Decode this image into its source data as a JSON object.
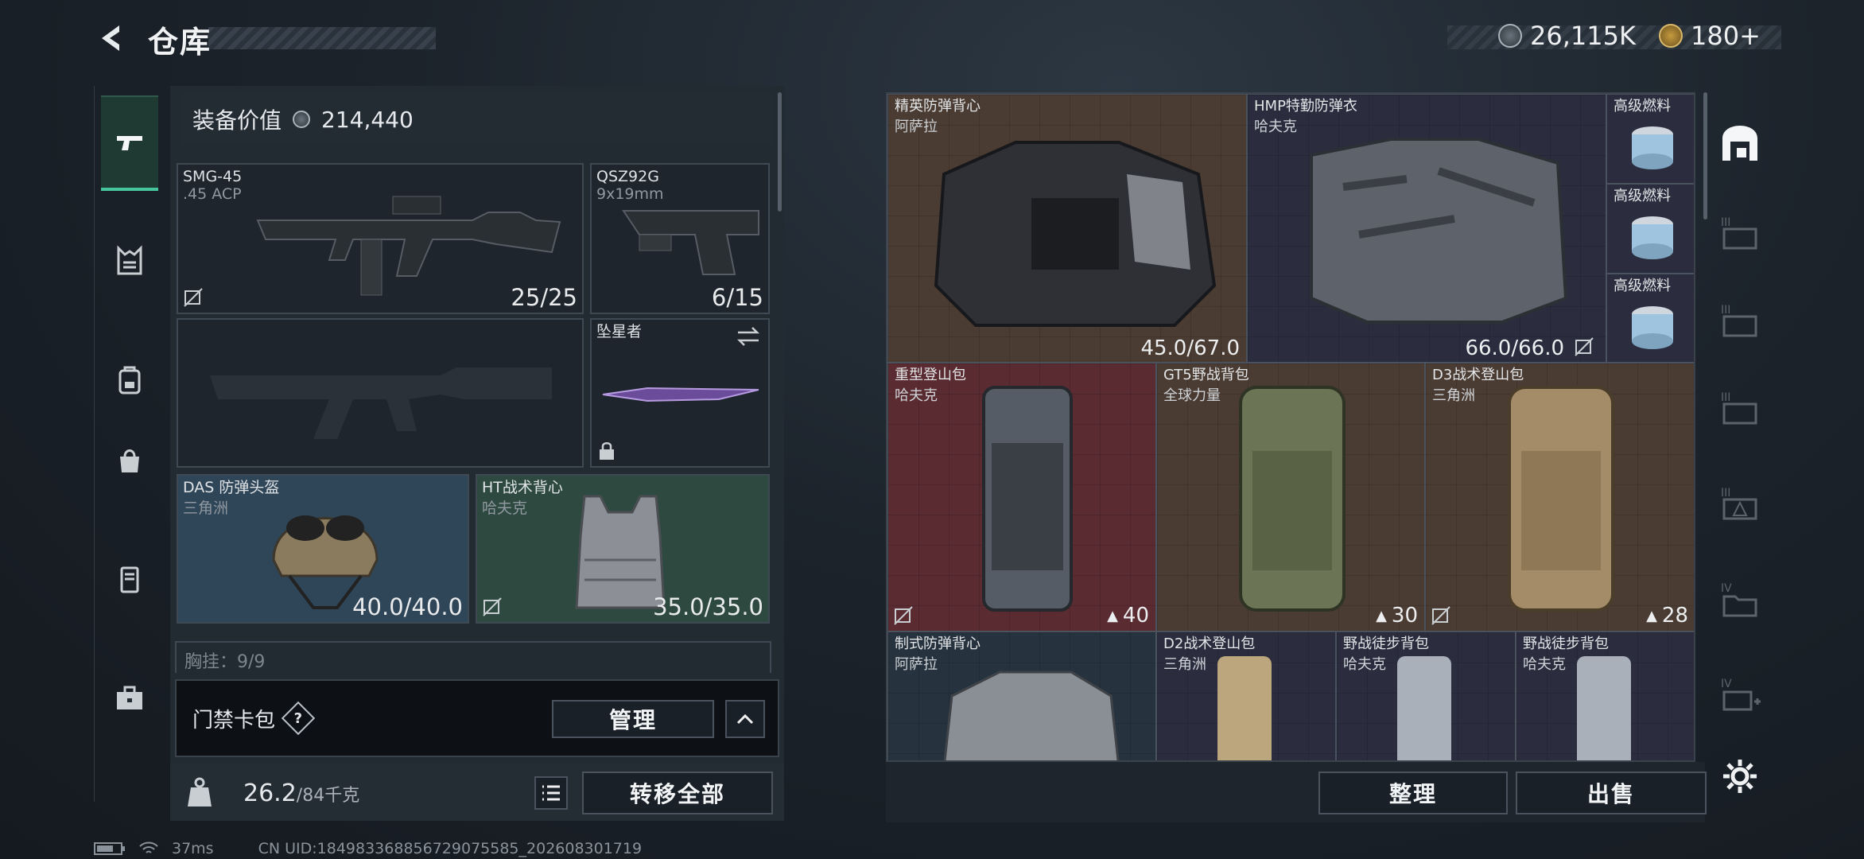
{
  "header": {
    "title": "仓库",
    "currency_silver": "26,115K",
    "currency_gold": "180+"
  },
  "equipment": {
    "value_label": "装备价值",
    "value": "214,440",
    "primary": {
      "name": "SMG-45",
      "ammo": ".45 ACP",
      "rounds": "25/25"
    },
    "secondary": {
      "name": "QSZ92G",
      "ammo": "9x19mm",
      "rounds": "6/15"
    },
    "melee": {
      "name": "坠星者"
    },
    "helmet": {
      "name": "DAS 防弹头盔",
      "brand": "三角洲",
      "durability": "40.0/40.0"
    },
    "armor": {
      "name": "HT战术背心",
      "brand": "哈夫克",
      "durability": "35.0/35.0"
    },
    "chest_rig": "胸挂：9/9",
    "keycard_label": "门禁卡包",
    "manage_label": "管理",
    "weight_value": "26.2",
    "weight_max": "/84千克",
    "transfer_all_label": "转移全部"
  },
  "storage": {
    "items": [
      {
        "name": "精英防弹背心",
        "brand": "阿萨拉",
        "durability": "45.0/67.0"
      },
      {
        "name": "HMP特勤防弹衣",
        "brand": "哈夫克",
        "durability": "66.0/66.0"
      },
      {
        "name": "高级燃料"
      },
      {
        "name": "高级燃料"
      },
      {
        "name": "高级燃料"
      },
      {
        "name": "重型登山包",
        "brand": "哈夫克",
        "capacity": "40"
      },
      {
        "name": "GT5野战背包",
        "brand": "全球力量",
        "capacity": "30"
      },
      {
        "name": "D3战术登山包",
        "brand": "三角洲",
        "capacity": "28"
      },
      {
        "name": "制式防弹背心",
        "brand": "阿萨拉"
      },
      {
        "name": "D2战术登山包",
        "brand": "三角洲"
      },
      {
        "name": "野战徒步背包",
        "brand": "哈夫克"
      },
      {
        "name": "野战徒步背包",
        "brand": "哈夫克"
      }
    ],
    "sort_label": "整理",
    "sell_label": "出售"
  },
  "status": {
    "ping": "37ms",
    "uid": "CN UID:184983368856729075585_202608301719"
  },
  "colors": {
    "accent": "#46c59d",
    "tile_brown": "#4a3c33",
    "tile_red": "#5a2b31",
    "tile_navy": "#2b2d3f"
  }
}
